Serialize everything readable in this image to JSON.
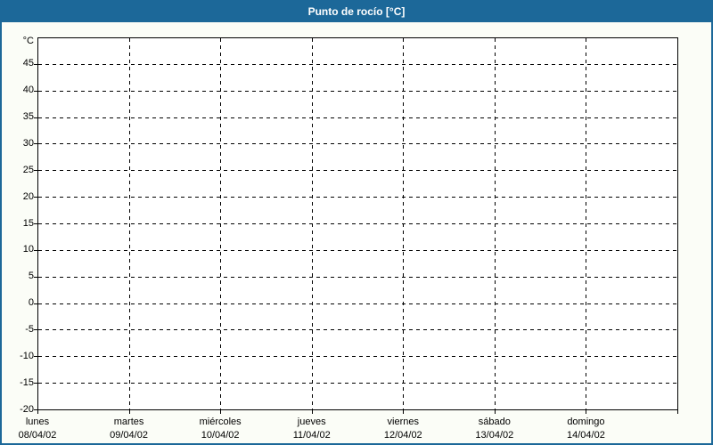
{
  "window": {
    "title": "Punto de rocío [°C]"
  },
  "colors": {
    "title_bar": "#1C6899",
    "title_text": "#FFFFFF",
    "window_background": "#FBFDF7",
    "plot_background": "#FFFFFF",
    "grid": "#000000",
    "axis_text": "#000000"
  },
  "chart_data": {
    "type": "line",
    "title": "Punto de rocío [°C]",
    "ylabel": "°C",
    "xlabel": "",
    "ylim": [
      -20,
      50
    ],
    "ytick_step": 5,
    "yticks": [
      45,
      40,
      35,
      30,
      25,
      20,
      15,
      10,
      5,
      0,
      -5,
      -10,
      -15,
      -20
    ],
    "grid": "dashed",
    "legend_position": "none",
    "categories": [
      {
        "day": "lunes",
        "date": "08/04/02"
      },
      {
        "day": "martes",
        "date": "09/04/02"
      },
      {
        "day": "miércoles",
        "date": "10/04/02"
      },
      {
        "day": "jueves",
        "date": "11/04/02"
      },
      {
        "day": "viernes",
        "date": "12/04/02"
      },
      {
        "day": "sábado",
        "date": "13/04/02"
      },
      {
        "day": "domingo",
        "date": "14/04/02"
      }
    ],
    "series": []
  }
}
